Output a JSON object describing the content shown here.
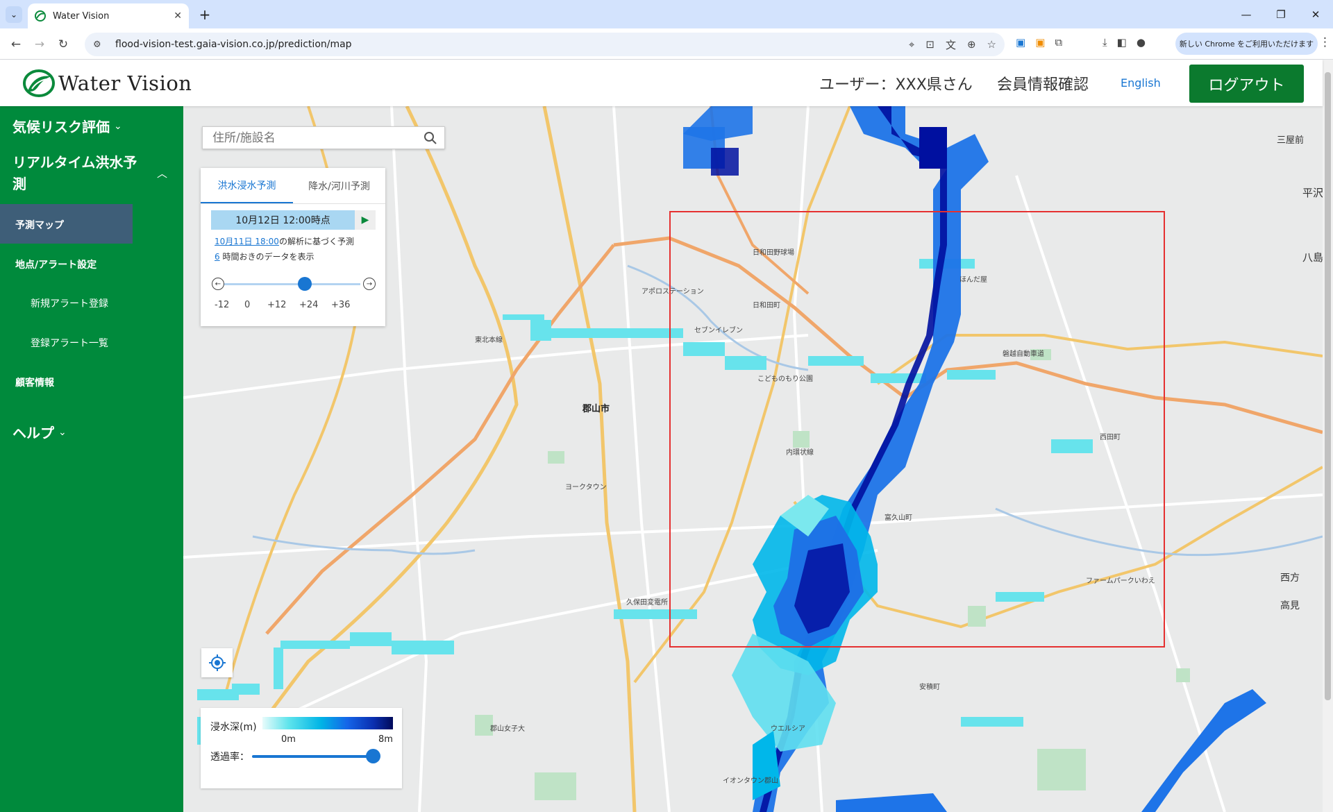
{
  "browser": {
    "tab_title": "Water Vision",
    "url": "flood-vision-test.gaia-vision.co.jp/prediction/map",
    "chrome_promo": "新しい Chrome をご利用いただけます"
  },
  "header": {
    "logo_text": "Water Vision",
    "user_label": "ユーザー：XXX県さん",
    "member_info": "会員情報確認",
    "english": "English",
    "logout": "ログアウト"
  },
  "sidebar": {
    "climate_risk": "気候リスク評価",
    "realtime_line1": "リアルタイム洪水予",
    "realtime_line2": "測",
    "forecast_map": "予測マップ",
    "alert_settings": "地点/アラート設定",
    "new_alert": "新規アラート登録",
    "alert_list": "登録アラート一覧",
    "customer_info": "顧客情報",
    "help": "ヘルプ"
  },
  "search": {
    "placeholder": "住所/施設名"
  },
  "forecast_panel": {
    "tab_flood": "洪水浸水予測",
    "tab_rain": "降水/河川予測",
    "datetime": "10月12日 12:00時点",
    "analysis_link": "10月11日 18:00",
    "analysis_suffix": "の解析に基づく予測",
    "interval_link": "6",
    "interval_suffix": " 時間おきのデータを表示",
    "ticks": [
      "-12",
      "0",
      "+12",
      "+24",
      "+36"
    ],
    "slider_value": "+12"
  },
  "legend": {
    "depth_label": "浸水深(m)",
    "min": "0m",
    "max": "8m",
    "transparency_label": "透過率：",
    "transparency_value": 1.0
  },
  "map_labels": [
    {
      "text": "郡山市",
      "bold": true
    },
    {
      "text": "平沢"
    },
    {
      "text": "八島"
    },
    {
      "text": "三屋前"
    },
    {
      "text": "西方"
    },
    {
      "text": "高見"
    },
    {
      "text": "こどものもり公園"
    },
    {
      "text": "セブンイレブン"
    },
    {
      "text": "ヨークタウン"
    },
    {
      "text": "イオンタウン郡山"
    },
    {
      "text": "ファームパークいわえ"
    },
    {
      "text": "日和田野球場"
    },
    {
      "text": "アポロステーション"
    },
    {
      "text": "内環状線"
    },
    {
      "text": "ウエルシア"
    },
    {
      "text": "富久山町"
    },
    {
      "text": "西田町"
    },
    {
      "text": "東北本線"
    },
    {
      "text": "磐越自動車道"
    },
    {
      "text": "久保田変電所"
    },
    {
      "text": "郡山女子大"
    },
    {
      "text": "ほんだ屋"
    },
    {
      "text": "日和田町"
    },
    {
      "text": "安積町"
    }
  ],
  "colors": {
    "sidebar": "#008a3c",
    "active_item": "#3e5e78",
    "logout": "#0b7a2e",
    "link": "#1976d2",
    "aoi_box": "#e53030"
  }
}
